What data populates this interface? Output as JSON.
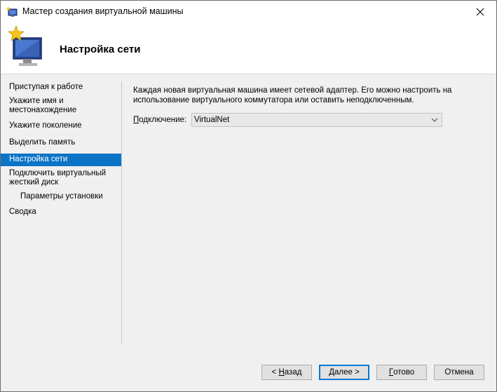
{
  "window": {
    "title": "Мастер создания виртуальной машины"
  },
  "header": {
    "title": "Настройка сети"
  },
  "nav": {
    "items": [
      {
        "label": "Приступая к работе",
        "active": false,
        "sub": false
      },
      {
        "label": "Укажите имя и\nместонахождение",
        "active": false,
        "sub": false
      },
      {
        "label": "Укажите поколение",
        "active": false,
        "sub": false
      },
      {
        "label": "Выделить память",
        "active": false,
        "sub": false
      },
      {
        "label": "Настройка сети",
        "active": true,
        "sub": false
      },
      {
        "label": "Подключить виртуальный\nжесткий диск",
        "active": false,
        "sub": false
      },
      {
        "label": "Параметры установки",
        "active": false,
        "sub": true
      },
      {
        "label": "Сводка",
        "active": false,
        "sub": false
      }
    ]
  },
  "content": {
    "description": "Каждая новая виртуальная машина имеет сетевой адаптер. Его можно настроить на\nиспользование виртуального коммутатора или оставить неподключенным.",
    "connection_label_u": "П",
    "connection_label_rest": "одключение:",
    "connection_value": "VirtualNet"
  },
  "buttons": {
    "back_prefix": "< ",
    "back_u": "Н",
    "back_rest": "азад",
    "next_u": "Д",
    "next_rest": "алее >",
    "finish_u": "Г",
    "finish_rest": "отово",
    "cancel": "Отмена"
  },
  "colors": {
    "active_nav": "#0c74c6",
    "default_button_border": "#0078d7"
  },
  "icons": {
    "title": "hyperv-wizard-icon",
    "header": "computer-monitor-star-icon",
    "close": "close-icon",
    "dropdown": "chevron-down-icon"
  }
}
